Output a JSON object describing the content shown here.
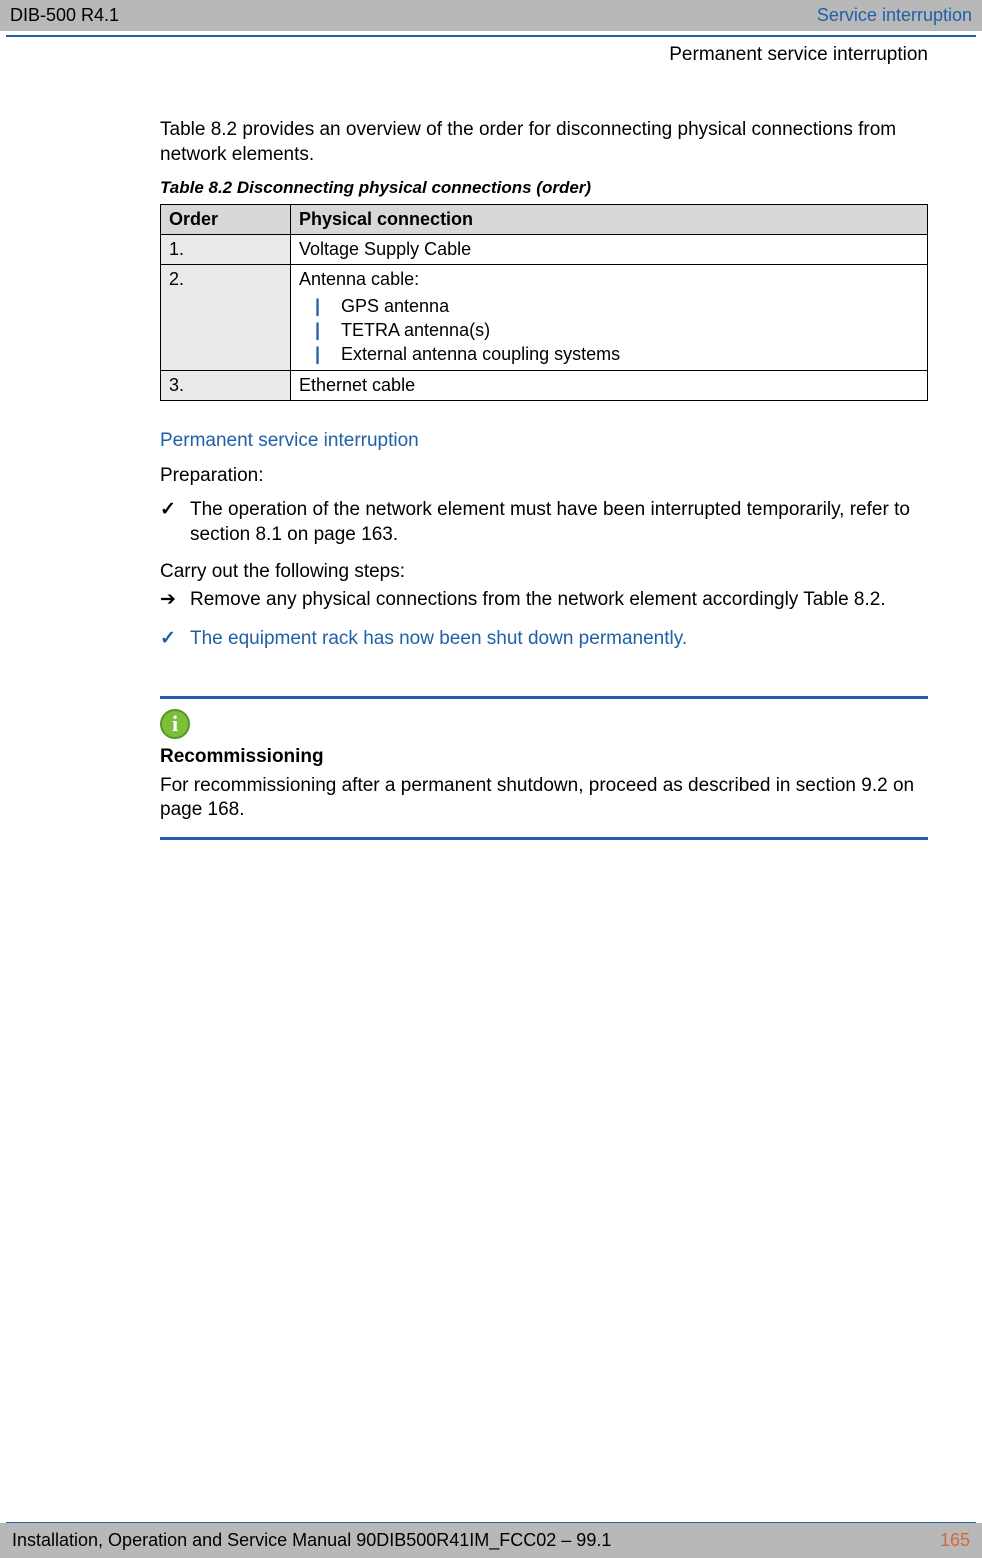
{
  "header": {
    "left": "DIB-500 R4.1",
    "right": "Service interruption",
    "sub": "Permanent service interruption"
  },
  "intro": "Table 8.2 provides an overview of the order for disconnecting physical connections from network elements.",
  "table": {
    "caption": "Table 8.2    Disconnecting physical connections (order)",
    "head_order": "Order",
    "head_physical": "Physical connection",
    "rows": [
      {
        "order": "1.",
        "value": "Voltage Supply Cable"
      },
      {
        "order": "2.",
        "value": "Antenna cable:",
        "sub": [
          "GPS antenna",
          "TETRA antenna(s)",
          "External antenna coupling systems"
        ]
      },
      {
        "order": "3.",
        "value": "Ethernet cable"
      }
    ]
  },
  "section_title": "Permanent service interruption",
  "prep_label": "Preparation:",
  "prep_item": "The operation of the network element must have been interrupted temporarily, refer to section 8.1 on page 163.",
  "carry_label": "Carry out the following steps:",
  "carry_item": "Remove any physical connections from the network element accordingly Table 8.2.",
  "result_item": "The equipment rack has now been shut down permanently.",
  "info": {
    "title": "Recommissioning",
    "body": "For recommissioning after a permanent shutdown, proceed as described in section 9.2 on page 168."
  },
  "footer": {
    "left": "Installation, Operation and Service Manual 90DIB500R41IM_FCC02  –  99.1",
    "right": "165"
  }
}
